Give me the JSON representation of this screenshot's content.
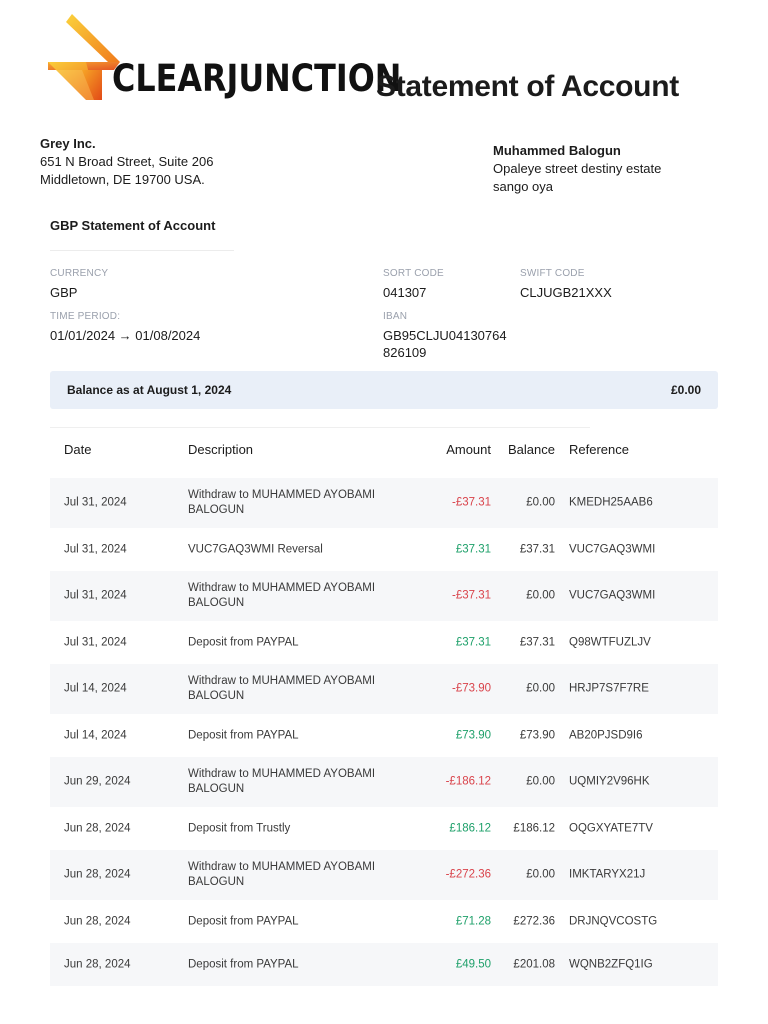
{
  "header": {
    "logo_text": "CLEARJUNCTION",
    "title": "Statement of Account"
  },
  "company": {
    "name": "Grey Inc.",
    "address_line1": "651 N Broad Street, Suite 206",
    "address_line2": "Middletown, DE 19700 USA."
  },
  "client": {
    "name": "Muhammed Balogun",
    "address_line1": "Opaleye street destiny estate",
    "address_line2": "sango oya"
  },
  "statement": {
    "section_title": "GBP Statement of Account",
    "currency_label": "CURRENCY",
    "currency": "GBP",
    "sort_code_label": "SORT CODE",
    "sort_code": "041307",
    "swift_label": "SWIFT CODE",
    "swift": "CLJUGB21XXX",
    "period_label": "TIME PERIOD:",
    "period": "01/01/2024 → 01/08/2024",
    "iban_label": "IBAN",
    "iban_line1": "GB95CLJU04130764",
    "iban_line2": "826109"
  },
  "balance": {
    "label": "Balance as at August 1, 2024",
    "value": "£0.00"
  },
  "table": {
    "headers": {
      "date": "Date",
      "description": "Description",
      "amount": "Amount",
      "balance": "Balance",
      "reference": "Reference"
    },
    "rows": [
      {
        "date": "Jul 31, 2024",
        "description": "Withdraw to MUHAMMED AYOBAMI BALOGUN",
        "amount": "-£37.31",
        "balance": "£0.00",
        "reference": "KMEDH25AAB6"
      },
      {
        "date": "Jul 31, 2024",
        "description": "VUC7GAQ3WMI Reversal",
        "amount": "£37.31",
        "balance": "£37.31",
        "reference": "VUC7GAQ3WMI"
      },
      {
        "date": "Jul 31, 2024",
        "description": "Withdraw to MUHAMMED AYOBAMI BALOGUN",
        "amount": "-£37.31",
        "balance": "£0.00",
        "reference": "VUC7GAQ3WMI"
      },
      {
        "date": "Jul 31, 2024",
        "description": "Deposit from PAYPAL",
        "amount": "£37.31",
        "balance": "£37.31",
        "reference": "Q98WTFUZLJV"
      },
      {
        "date": "Jul 14, 2024",
        "description": "Withdraw to MUHAMMED AYOBAMI BALOGUN",
        "amount": "-£73.90",
        "balance": "£0.00",
        "reference": "HRJP7S7F7RE"
      },
      {
        "date": "Jul 14, 2024",
        "description": "Deposit from PAYPAL",
        "amount": "£73.90",
        "balance": "£73.90",
        "reference": "AB20PJSD9I6"
      },
      {
        "date": "Jun 29, 2024",
        "description": "Withdraw to MUHAMMED AYOBAMI BALOGUN",
        "amount": "-£186.12",
        "balance": "£0.00",
        "reference": "UQMIY2V96HK"
      },
      {
        "date": "Jun 28, 2024",
        "description": "Deposit from Trustly",
        "amount": "£186.12",
        "balance": "£186.12",
        "reference": "OQGXYATE7TV"
      },
      {
        "date": "Jun 28, 2024",
        "description": "Withdraw to MUHAMMED AYOBAMI BALOGUN",
        "amount": "-£272.36",
        "balance": "£0.00",
        "reference": "IMKTARYX21J"
      },
      {
        "date": "Jun 28, 2024",
        "description": "Deposit from PAYPAL",
        "amount": "£71.28",
        "balance": "£272.36",
        "reference": "DRJNQVCOSTG"
      },
      {
        "date": "Jun 28, 2024",
        "description": "Deposit from PAYPAL",
        "amount": "£49.50",
        "balance": "£201.08",
        "reference": "WQNB2ZFQ1IG"
      }
    ]
  },
  "colors": {
    "debit": "#d9434b",
    "credit": "#1ea06a",
    "logo_orange": "#f5a623",
    "logo_red": "#e8501a"
  }
}
